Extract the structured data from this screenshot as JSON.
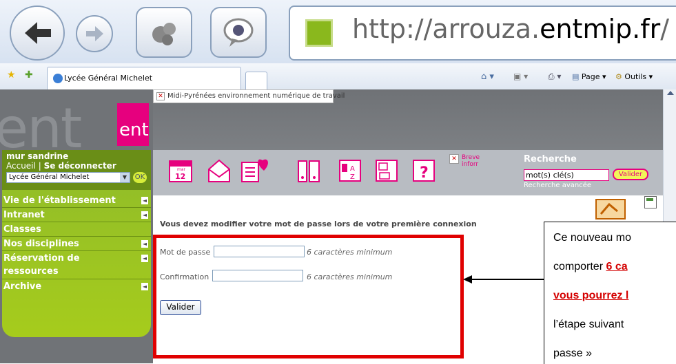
{
  "browser": {
    "url_prefix": "http://arrouza.",
    "url_domain": "entmip.fr",
    "url_suffix": "/",
    "tab_title": "Lycée Général Michelet",
    "toolbar": {
      "page": "Page",
      "outils": "Outils"
    }
  },
  "header": {
    "logo_text": "ent",
    "broken_image_text": "Midi-Pyrénées environnement numérique de travail",
    "breve_text": "Breve inforr",
    "calendar_month": "mar",
    "calendar_day": "12"
  },
  "user": {
    "name": "mur sandrine",
    "accueil": "Accueil",
    "separator": "|",
    "logout": "Se déconnecter",
    "school_select": "Lycée Général Michelet",
    "ok": "OK"
  },
  "search": {
    "title": "Recherche",
    "value": "mot(s) clé(s)",
    "button": "Valider",
    "advanced": "Recherche avancée"
  },
  "menu": [
    {
      "label": "Vie de l'établissement",
      "arrow": true
    },
    {
      "label": "Intranet",
      "arrow": true
    },
    {
      "label": "Classes",
      "arrow": false
    },
    {
      "label": "Nos disciplines",
      "arrow": true
    },
    {
      "label": "Réservation de",
      "label2": "ressources",
      "arrow": true
    },
    {
      "label": "Archive",
      "arrow": true
    }
  ],
  "form": {
    "heading": "Vous devez modifier votre mot de passe lors de votre première connexion",
    "password_label": "Mot de passe",
    "password_hint": "6 caractères minimum",
    "confirm_label": "Confirmation",
    "confirm_hint": "6 caractères minimum",
    "submit": "Valider"
  },
  "callout": {
    "line1": "Ce nouveau mo",
    "line2a": "comporter ",
    "line2b": "6 ca",
    "line3": "vous pourrez l",
    "line4": "l’étape suivant",
    "line5": "passe »"
  },
  "colors": {
    "accent_pink": "#e6007e",
    "green": "#9cc41f",
    "highlight_red": "#e00000"
  }
}
